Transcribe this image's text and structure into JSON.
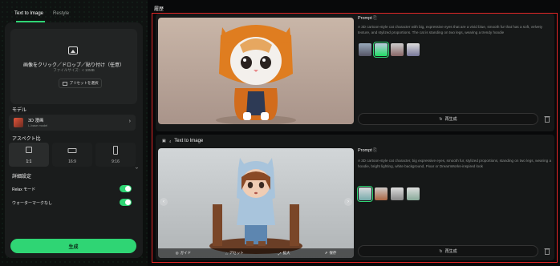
{
  "tabs": [
    {
      "label": "Text to Image"
    },
    {
      "label": "Restyle"
    }
  ],
  "upload": {
    "title": "画像をクリック／ドロップ／貼り付け（任意）",
    "subtitle": "ファイルサイズ：< 10MB",
    "preset_button": "プリセットを選択"
  },
  "model": {
    "section_label": "モデル",
    "name": "3D 漫画",
    "sub": "L-base model"
  },
  "aspect": {
    "section_label": "アスペクト比",
    "options": [
      {
        "label": "1:1",
        "selected": true
      },
      {
        "label": "16:9",
        "selected": false
      },
      {
        "label": "9:16",
        "selected": false
      }
    ]
  },
  "advanced": {
    "section_label": "詳細設定",
    "relax_label": "Relax モード",
    "relax_on": true,
    "watermark_label": "ウォーターマークなし",
    "watermark_on": true
  },
  "generate_button": "生成",
  "history": {
    "title": "履歴",
    "card1": {
      "prompt_label": "Prompt",
      "prompt_text": "A 3D cartoon-style cat character with big, expressive eyes that are a vivid blue, smooth fur that has a soft, velvety texture, and stylized proportions. The cat is standing on two legs, wearing a trendy hoodie",
      "regenerate": "再生成"
    },
    "card2": {
      "head_badge": "4",
      "head_title": "Text to Image",
      "prompt_label": "Prompt",
      "prompt_text": "A 3D cartoon-style cat character, big expressive eyes, smooth fur, stylized proportions, standing on two legs, wearing a hoodie, bright lighting, white background, Pixar or DreamWorks-inspired look",
      "regenerate": "再生成",
      "tools": [
        "ガイド",
        "アセット",
        "拡大",
        "保存"
      ]
    }
  },
  "colors": {
    "accent": "#2fd574",
    "highlight_border": "#e02626"
  }
}
